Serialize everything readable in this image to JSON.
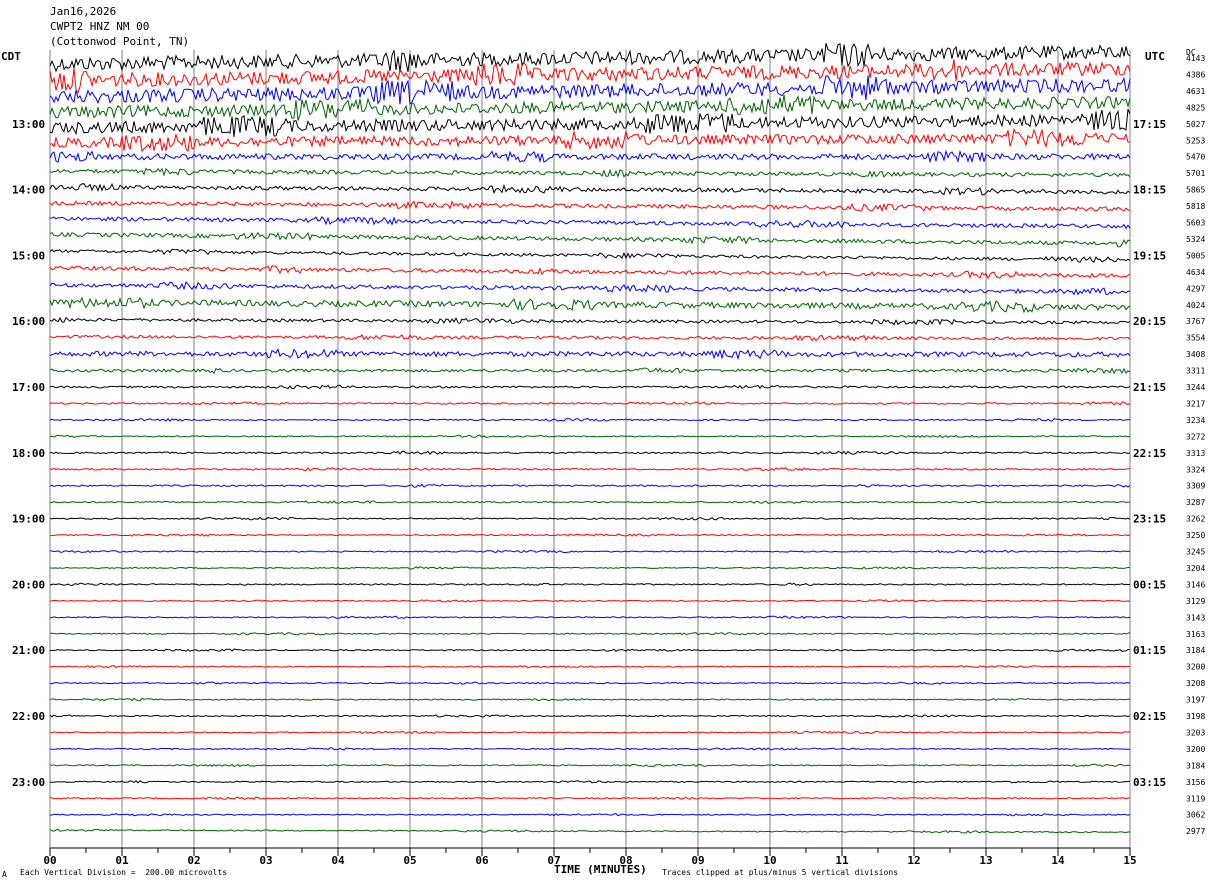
{
  "header": {
    "date": "Jan16,2026",
    "station": "CWPT2 HNZ NM 00",
    "location": "(Cottonwod Point, TN)",
    "left_tz": "CDT",
    "right_tz": "UTC",
    "dc_label": "DC"
  },
  "footer": {
    "scale_note": "Each Vertical Division =  200.00 microvolts",
    "clip_note": "Traces clipped at plus/minus 5 vertical divisions",
    "x_title": "TIME (MINUTES)",
    "corner_mark": "A"
  },
  "colors": {
    "trace_cycle": [
      "#000000",
      "#ff0000",
      "#0000ff",
      "#006400"
    ],
    "grid": "#808080",
    "background": "#ffffff"
  },
  "chart_data": {
    "type": "line",
    "kind": "helicorder seismogram",
    "xlabel": "TIME (MINUTES)",
    "xlim": [
      0,
      15
    ],
    "x_ticks": [
      "00",
      "01",
      "02",
      "03",
      "04",
      "05",
      "06",
      "07",
      "08",
      "09",
      "10",
      "11",
      "12",
      "13",
      "14",
      "15"
    ],
    "minor_tick_step_minutes": 0.5,
    "grid": true,
    "rows_per_hour": 4,
    "left_labels": [
      {
        "row": 4,
        "text": "13:00"
      },
      {
        "row": 8,
        "text": "14:00"
      },
      {
        "row": 12,
        "text": "15:00"
      },
      {
        "row": 16,
        "text": "16:00"
      },
      {
        "row": 20,
        "text": "17:00"
      },
      {
        "row": 24,
        "text": "18:00"
      },
      {
        "row": 28,
        "text": "19:00"
      },
      {
        "row": 32,
        "text": "20:00"
      },
      {
        "row": 36,
        "text": "21:00"
      },
      {
        "row": 40,
        "text": "22:00"
      },
      {
        "row": 44,
        "text": "23:00"
      }
    ],
    "right_labels": [
      {
        "row": 4,
        "text": "17:15"
      },
      {
        "row": 8,
        "text": "18:15"
      },
      {
        "row": 12,
        "text": "19:15"
      },
      {
        "row": 16,
        "text": "20:15"
      },
      {
        "row": 20,
        "text": "21:15"
      },
      {
        "row": 24,
        "text": "22:15"
      },
      {
        "row": 28,
        "text": "23:15"
      },
      {
        "row": 32,
        "text": "00:15"
      },
      {
        "row": 36,
        "text": "01:15"
      },
      {
        "row": 40,
        "text": "02:15"
      },
      {
        "row": 44,
        "text": "03:15"
      }
    ],
    "dc_offsets": [
      "4143",
      "4386",
      "4631",
      "4825",
      "5027",
      "5253",
      "5470",
      "5701",
      "5865",
      "5818",
      "5603",
      "5324",
      "5005",
      "4634",
      "4297",
      "4024",
      "3767",
      "3554",
      "3408",
      "3311",
      "3244",
      "3217",
      "3234",
      "3272",
      "3313",
      "3324",
      "3309",
      "3287",
      "3262",
      "3250",
      "3245",
      "3204",
      "3146",
      "3129",
      "3143",
      "3163",
      "3184",
      "3200",
      "3208",
      "3197",
      "3198",
      "3203",
      "3200",
      "3184",
      "3156",
      "3119",
      "3062",
      "2977"
    ],
    "trace_amplitude": [
      7,
      7,
      7,
      6,
      6,
      5,
      3,
      2,
      2,
      2,
      2,
      2,
      1.5,
      2,
      2,
      3,
      1.5,
      1.5,
      2.5,
      1.5,
      1,
      0.8,
      0.7,
      0.6,
      0.8,
      0.8,
      0.8,
      0.7,
      0.7,
      0.6,
      0.6,
      0.6,
      0.7,
      0.6,
      0.6,
      0.6,
      0.6,
      0.6,
      0.6,
      0.6,
      0.6,
      0.6,
      0.6,
      0.6,
      0.6,
      0.6,
      0.6,
      0.6
    ],
    "trace_drift": [
      12,
      12,
      12,
      10,
      8,
      5,
      0,
      -4,
      -5,
      -6,
      -8,
      -9,
      -9,
      -8,
      -7,
      -5,
      -3,
      -2,
      -1,
      0,
      0,
      0,
      0,
      0,
      0,
      0,
      0,
      0,
      0,
      0,
      0,
      0,
      0,
      0,
      0,
      0,
      0,
      0,
      0,
      0,
      0,
      0,
      0,
      0,
      0,
      0,
      0,
      -2
    ]
  }
}
